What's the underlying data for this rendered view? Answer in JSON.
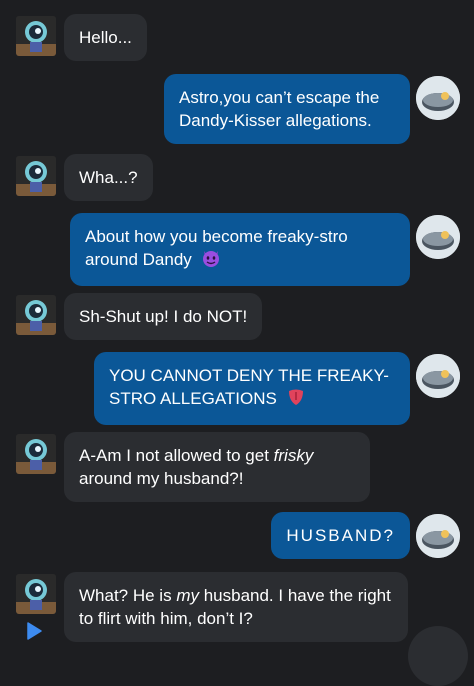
{
  "messages": [
    {
      "side": "in",
      "text": "Hello..."
    },
    {
      "side": "out",
      "text": "Astro,you can’t escape the Dandy-Kisser allegations."
    },
    {
      "side": "in",
      "text": "Wha...?"
    },
    {
      "side": "out",
      "text": "About how you become freaky-stro around Dandy",
      "emoji": "smiling-imp-emoji"
    },
    {
      "side": "in",
      "text": "Sh-Shut up! I do NOT!"
    },
    {
      "side": "out",
      "text": "YOU CANNOT DENY THE FREAKY-STRO ALLEGATIONS",
      "emoji": "tongue-emoji"
    },
    {
      "side": "in",
      "text_before": "A-Am I not allowed to get ",
      "text_italic": "frisky",
      "text_after": " around my husband?!"
    },
    {
      "side": "out",
      "text": "HUSBAND?"
    },
    {
      "side": "in",
      "text_before": "What? He is ",
      "text_italic": "my",
      "text_after": " husband. I have the right to flirt with him, don’t I?"
    }
  ],
  "colors": {
    "background": "#1d1e21",
    "incoming_bubble": "#2b2d31",
    "outgoing_bubble": "#0b5797",
    "text": "#ffffff"
  },
  "icons": {
    "left_avatar": "astro-avatar",
    "right_avatar": "cloud-moon-avatar",
    "play": "play-icon"
  }
}
